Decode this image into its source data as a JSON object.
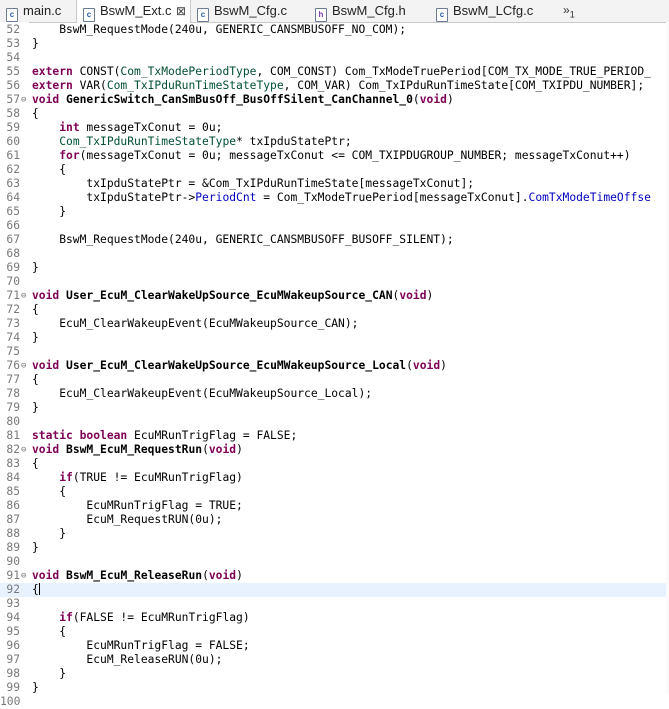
{
  "tabs": [
    {
      "label": "main.c",
      "icon": "c",
      "active": false
    },
    {
      "label": "BswM_Ext.c",
      "icon": "c",
      "active": true
    },
    {
      "label": "BswM_Cfg.c",
      "icon": "c",
      "active": false
    },
    {
      "label": "BswM_Cfg.h",
      "icon": "h",
      "active": false
    },
    {
      "label": "BswM_LCfg.c",
      "icon": "c",
      "active": false
    }
  ],
  "overflow": {
    "chevron": "»",
    "count": "1"
  },
  "editor": {
    "current_line": "92",
    "lines": [
      {
        "n": "52",
        "t": "    BswM_RequestMode(240u, GENERIC_CANSMBUSOFF_NO_COM);"
      },
      {
        "n": "53",
        "t": "}"
      },
      {
        "n": "54",
        "t": ""
      },
      {
        "n": "55",
        "t": "extern CONST(Com_TxModePeriodType, COM_CONST) Com_TxModeTruePeriod[COM_TX_MODE_TRUE_PERIOD_"
      },
      {
        "n": "56",
        "t": "extern VAR(Com_TxIPduRunTimeStateType, COM_VAR) Com_TxIPduRunTimeState[COM_TXIPDU_NUMBER];"
      },
      {
        "n": "57",
        "t": "void GenericSwitch_CanSmBusOff_BusOffSilent_CanChannel_0(void)",
        "fold": true
      },
      {
        "n": "58",
        "t": "{"
      },
      {
        "n": "59",
        "t": "    int messageTxConut = 0u;"
      },
      {
        "n": "60",
        "t": "    Com_TxIPduRunTimeStateType* txIpduStatePtr;"
      },
      {
        "n": "61",
        "t": "    for(messageTxConut = 0u; messageTxConut <= COM_TXIPDUGROUP_NUMBER; messageTxConut++)"
      },
      {
        "n": "62",
        "t": "    {"
      },
      {
        "n": "63",
        "t": "        txIpduStatePtr = &Com_TxIPduRunTimeState[messageTxConut];"
      },
      {
        "n": "64",
        "t": "        txIpduStatePtr->PeriodCnt = Com_TxModeTruePeriod[messageTxConut].ComTxModeTimeOffse"
      },
      {
        "n": "65",
        "t": "    }"
      },
      {
        "n": "66",
        "t": ""
      },
      {
        "n": "67",
        "t": "    BswM_RequestMode(240u, GENERIC_CANSMBUSOFF_BUSOFF_SILENT);"
      },
      {
        "n": "68",
        "t": ""
      },
      {
        "n": "69",
        "t": "}"
      },
      {
        "n": "70",
        "t": ""
      },
      {
        "n": "71",
        "t": "void User_EcuM_ClearWakeUpSource_EcuMWakeupSource_CAN(void)",
        "fold": true
      },
      {
        "n": "72",
        "t": "{"
      },
      {
        "n": "73",
        "t": "    EcuM_ClearWakeupEvent(EcuMWakeupSource_CAN);"
      },
      {
        "n": "74",
        "t": "}"
      },
      {
        "n": "75",
        "t": ""
      },
      {
        "n": "76",
        "t": "void User_EcuM_ClearWakeUpSource_EcuMWakeupSource_Local(void)",
        "fold": true
      },
      {
        "n": "77",
        "t": "{"
      },
      {
        "n": "78",
        "t": "    EcuM_ClearWakeupEvent(EcuMWakeupSource_Local);"
      },
      {
        "n": "79",
        "t": "}"
      },
      {
        "n": "80",
        "t": ""
      },
      {
        "n": "81",
        "t": "static boolean EcuMRunTrigFlag = FALSE;"
      },
      {
        "n": "82",
        "t": "void BswM_EcuM_RequestRun(void)",
        "fold": true
      },
      {
        "n": "83",
        "t": "{"
      },
      {
        "n": "84",
        "t": "    if(TRUE != EcuMRunTrigFlag)"
      },
      {
        "n": "85",
        "t": "    {"
      },
      {
        "n": "86",
        "t": "        EcuMRunTrigFlag = TRUE;"
      },
      {
        "n": "87",
        "t": "        EcuM_RequestRUN(0u);"
      },
      {
        "n": "88",
        "t": "    }"
      },
      {
        "n": "89",
        "t": "}"
      },
      {
        "n": "90",
        "t": ""
      },
      {
        "n": "91",
        "t": "void BswM_EcuM_ReleaseRun(void)",
        "fold": true
      },
      {
        "n": "92",
        "t": "{"
      },
      {
        "n": "93",
        "t": ""
      },
      {
        "n": "94",
        "t": "    if(FALSE != EcuMRunTrigFlag)"
      },
      {
        "n": "95",
        "t": "    {"
      },
      {
        "n": "96",
        "t": "        EcuMRunTrigFlag = FALSE;"
      },
      {
        "n": "97",
        "t": "        EcuM_ReleaseRUN(0u);"
      },
      {
        "n": "98",
        "t": "    }"
      },
      {
        "n": "99",
        "t": "}"
      },
      {
        "n": "100",
        "t": ""
      }
    ]
  },
  "colors": {
    "keyword": "#7f0055",
    "type": "#005032",
    "field": "#0000c0",
    "line_number": "#787878",
    "current_line_bg": "#e8f2fe"
  }
}
